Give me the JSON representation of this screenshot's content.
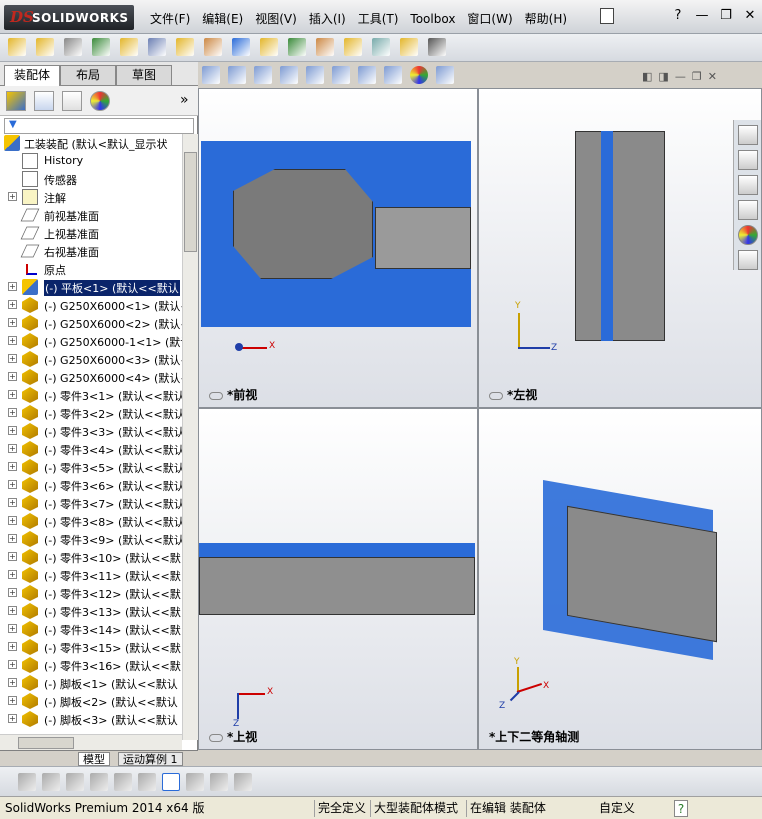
{
  "app": {
    "logo_ds": "DS",
    "logo_text": "SOLIDWORKS"
  },
  "menu": [
    "文件(F)",
    "编辑(E)",
    "视图(V)",
    "插入(I)",
    "工具(T)",
    "Toolbox",
    "窗口(W)",
    "帮助(H)"
  ],
  "window_controls": {
    "help": "?",
    "min": "—",
    "restore": "❐",
    "close": "✕"
  },
  "left_panel": {
    "tabs": [
      "装配体",
      "布局",
      "草图"
    ],
    "more": "»",
    "filter": "▼",
    "tree": [
      {
        "label": "工装装配  (默认<默认_显示状",
        "icon": "asm",
        "root": true
      },
      {
        "label": "History",
        "icon": "hist"
      },
      {
        "label": "传感器",
        "icon": "sens"
      },
      {
        "label": "注解",
        "icon": "anno",
        "expand": true
      },
      {
        "label": "前视基准面",
        "icon": "plane"
      },
      {
        "label": "上视基准面",
        "icon": "plane"
      },
      {
        "label": "右视基准面",
        "icon": "plane"
      },
      {
        "label": "原点",
        "icon": "origin"
      },
      {
        "label": "(-) 平板<1> (默认<<默认",
        "icon": "asm",
        "expand": true,
        "selected": true
      },
      {
        "label": "(-) G250X6000<1> (默认<",
        "icon": "part",
        "expand": true
      },
      {
        "label": "(-) G250X6000<2> (默认<",
        "icon": "part",
        "expand": true
      },
      {
        "label": "(-) G250X6000-1<1> (默认",
        "icon": "part",
        "expand": true
      },
      {
        "label": "(-) G250X6000<3> (默认<",
        "icon": "part",
        "expand": true
      },
      {
        "label": "(-) G250X6000<4> (默认<",
        "icon": "part",
        "expand": true
      },
      {
        "label": "(-) 零件3<1> (默认<<默认",
        "icon": "part",
        "expand": true
      },
      {
        "label": "(-) 零件3<2> (默认<<默认",
        "icon": "part",
        "expand": true
      },
      {
        "label": "(-) 零件3<3> (默认<<默认",
        "icon": "part",
        "expand": true
      },
      {
        "label": "(-) 零件3<4> (默认<<默认",
        "icon": "part",
        "expand": true
      },
      {
        "label": "(-) 零件3<5> (默认<<默认",
        "icon": "part",
        "expand": true
      },
      {
        "label": "(-) 零件3<6> (默认<<默认",
        "icon": "part",
        "expand": true
      },
      {
        "label": "(-) 零件3<7> (默认<<默认",
        "icon": "part",
        "expand": true
      },
      {
        "label": "(-) 零件3<8> (默认<<默认",
        "icon": "part",
        "expand": true
      },
      {
        "label": "(-) 零件3<9> (默认<<默认",
        "icon": "part",
        "expand": true
      },
      {
        "label": "(-) 零件3<10> (默认<<默",
        "icon": "part",
        "expand": true
      },
      {
        "label": "(-) 零件3<11> (默认<<默",
        "icon": "part",
        "expand": true
      },
      {
        "label": "(-) 零件3<12> (默认<<默",
        "icon": "part",
        "expand": true
      },
      {
        "label": "(-) 零件3<13> (默认<<默",
        "icon": "part",
        "expand": true
      },
      {
        "label": "(-) 零件3<14> (默认<<默",
        "icon": "part",
        "expand": true
      },
      {
        "label": "(-) 零件3<15> (默认<<默",
        "icon": "part",
        "expand": true
      },
      {
        "label": "(-) 零件3<16> (默认<<默",
        "icon": "part",
        "expand": true
      },
      {
        "label": "(-) 脚板<1> (默认<<默认",
        "icon": "part",
        "expand": true
      },
      {
        "label": "(-) 脚板<2> (默认<<默认",
        "icon": "part",
        "expand": true
      },
      {
        "label": "(-) 脚板<3> (默认<<默认",
        "icon": "part",
        "expand": true
      }
    ],
    "bottom_tabs": [
      "模型",
      "运动算例 1"
    ]
  },
  "viewports": {
    "front": "*前视",
    "left": "*左视",
    "top": "*上视",
    "iso": "*上下二等角轴测"
  },
  "axes": {
    "x": "X",
    "y": "Y",
    "z": "Z"
  },
  "status": {
    "app": "SolidWorks Premium 2014 x64 版",
    "def": "完全定义",
    "mode": "大型装配体模式",
    "editing": "在编辑 装配体",
    "custom": "自定义",
    "help": "?"
  },
  "colors": {
    "accent": "#2a6bd8",
    "selected": "#0a246a"
  }
}
